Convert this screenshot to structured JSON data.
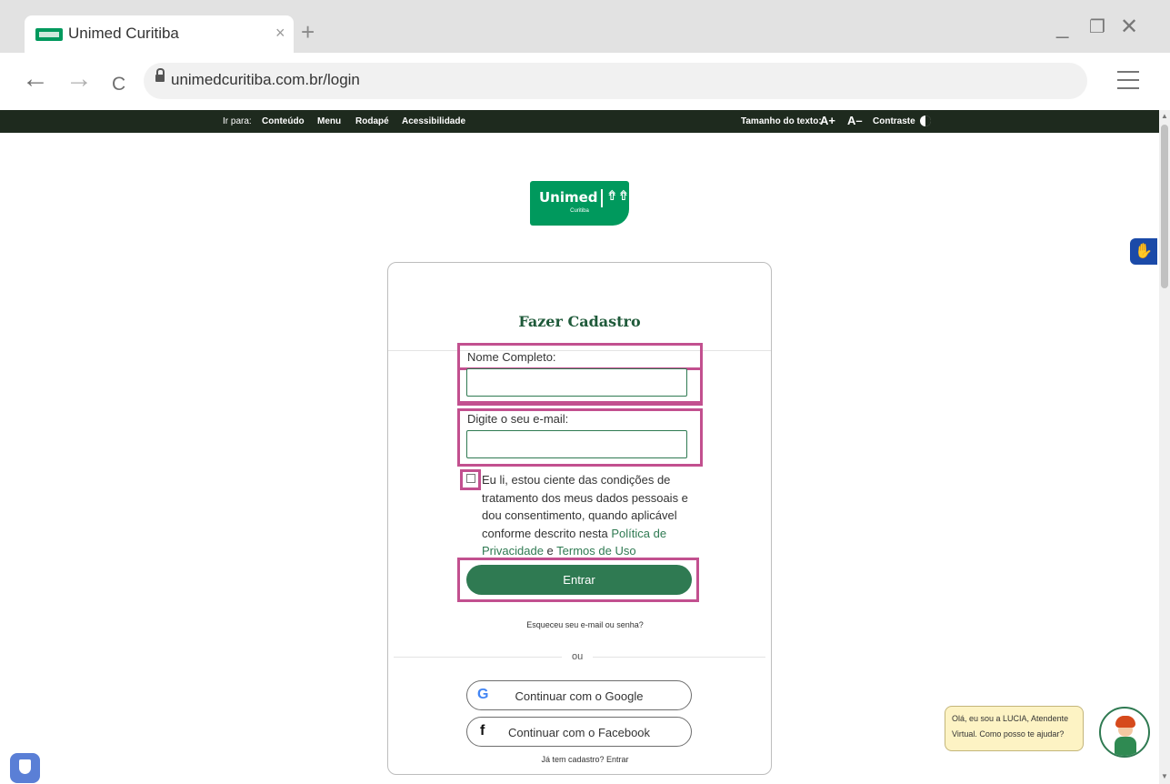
{
  "browser": {
    "tab_title": "Unimed Curitiba",
    "tab_close": "×",
    "new_tab": "+",
    "url": "unimedcuritiba.com.br/login",
    "minimize": "_",
    "restore": "❐",
    "close": "✕",
    "back": "←",
    "forward": "→",
    "reload": "C"
  },
  "accessibility_bar": {
    "ir_para": "Ir para:",
    "links": [
      "Conteúdo",
      "Menu",
      "Rodapé",
      "Acessibilidade"
    ],
    "tamanho_label": "Tamanho do texto:",
    "a_plus": "A+",
    "a_minus": "A–",
    "contraste": "Contraste"
  },
  "logo": {
    "name": "Unimed",
    "mark": "⇮⇮",
    "sub": "Curitiba"
  },
  "vlibras_icon": "✋",
  "form": {
    "title": "Fazer Cadastro",
    "name_label": "Nome Completo:",
    "name_value": "",
    "email_label": "Digite o seu e-mail:",
    "email_value": "",
    "consent_text": "Eu li, estou ciente das condições de tratamento dos meus dados pessoais e dou consentimento, quando aplicável conforme descrito nesta ",
    "privacy_link": "Política de Privacidade",
    "conjunction": " e ",
    "terms_link": "Termos de Uso",
    "submit": "Entrar",
    "forgot": "Esqueceu seu e-mail ou senha?",
    "or": "ou",
    "google": "Continuar com o Google",
    "google_icon": "G",
    "facebook": "Continuar com o Facebook",
    "facebook_icon": "f",
    "has_account": "Já tem cadastro? Entrar"
  },
  "chat": {
    "message": "Olá, eu sou a LUCIA, Atendente Virtual. Como posso te ajudar?"
  },
  "colors": {
    "brand_green": "#00995d",
    "button_green": "#2f7a52",
    "highlight": "#c2508f",
    "top_bar": "#1e2a1e"
  }
}
